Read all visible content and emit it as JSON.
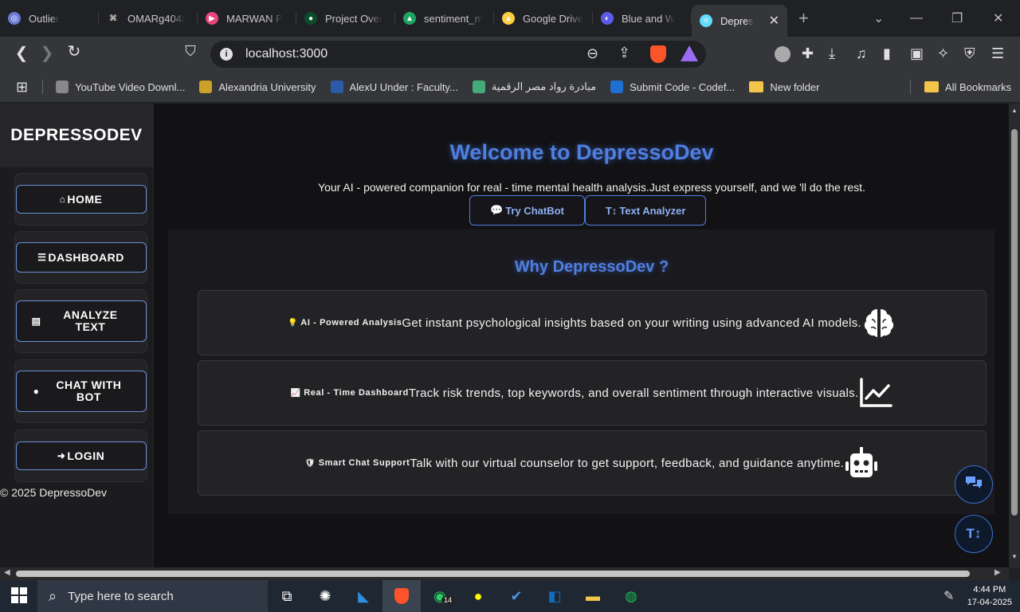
{
  "browser": {
    "tabs": [
      {
        "label": "Outlier",
        "color": "#6c7bd6",
        "glyph": "◎",
        "active": false
      },
      {
        "label": "OMARg404/",
        "color": "#222",
        "glyph": "⌘",
        "active": false
      },
      {
        "label": "MARWAN P",
        "color": "#e8457a",
        "glyph": "▶",
        "active": false
      },
      {
        "label": "Project Over",
        "color": "#0a4d2c",
        "glyph": "●",
        "active": false
      },
      {
        "label": "sentiment_m",
        "color": "#1fa463",
        "glyph": "▲",
        "active": false
      },
      {
        "label": "Google Drive",
        "color": "#ffcd40",
        "glyph": "▲",
        "active": false
      },
      {
        "label": "Blue and W",
        "color": "#5b5be8",
        "glyph": "◐",
        "active": false
      },
      {
        "label": "Depres",
        "color": "#61dafb",
        "glyph": "⚛",
        "active": true
      }
    ],
    "close_glyph": "✕",
    "newtab_glyph": "+",
    "url": "localhost:3000",
    "bookmarks": [
      {
        "label": "YouTube Video Downl...",
        "color": "#888"
      },
      {
        "label": "Alexandria University",
        "color": "#c9a227"
      },
      {
        "label": "AlexU Under : Faculty...",
        "color": "#2b5aa6"
      },
      {
        "label": "مبادرة رواد مصر الرقمية",
        "color": "#4a7"
      },
      {
        "label": "Submit Code - Codef...",
        "color": "#1f6fd0"
      },
      {
        "label": "New folder",
        "folder": true
      }
    ],
    "all_bookmarks": "All Bookmarks"
  },
  "sidebar": {
    "brand": "DEPRESSODEV",
    "items": [
      {
        "label": "HOME",
        "icon": "home-icon",
        "glyph": "⌂"
      },
      {
        "label": "DASHBOARD",
        "icon": "list-icon",
        "glyph": "☰"
      },
      {
        "label": "ANALYZE TEXT",
        "icon": "file-icon",
        "glyph": "▤"
      },
      {
        "label": "CHAT WITH BOT",
        "icon": "comment-icon",
        "glyph": "●"
      },
      {
        "label": "LOGIN",
        "icon": "login-icon",
        "glyph": "➜"
      }
    ],
    "copyright": "© 2025 DepressoDev"
  },
  "hero": {
    "title": "Welcome to DepressoDev",
    "subtitle": "Your AI - powered companion for real - time mental health analysis.Just express yourself, and we 'll do the rest.",
    "buttons": [
      {
        "label": "Try ChatBot",
        "icon": "comments-icon",
        "glyph": "💬"
      },
      {
        "label": "Text Analyzer",
        "icon": "text-height-icon",
        "glyph": "T↕"
      }
    ]
  },
  "why": {
    "title": "Why DepressoDev ?",
    "features": [
      {
        "tag_glyph": "💡",
        "title": "AI - Powered Analysis",
        "desc": "Get instant psychological insights based on your writing using advanced AI models.",
        "icon": "brain-icon"
      },
      {
        "tag_glyph": "📈",
        "title": "Real - Time Dashboard",
        "desc": "Track risk trends, top keywords, and overall sentiment through interactive visuals.",
        "icon": "chart-line-icon"
      },
      {
        "tag_glyph": "🛡",
        "title": "Smart Chat Support",
        "desc": "Talk with our virtual counselor to get support, feedback, and guidance anytime.",
        "icon": "robot-icon"
      }
    ]
  },
  "taskbar": {
    "search_placeholder": "Type here to search",
    "badge": "14",
    "time": "4:44 PM",
    "date": "17-04-2025"
  },
  "colors": {
    "accent": "#4f7fe0",
    "bg": "#121214",
    "sidebar": "#1c1c1f"
  }
}
